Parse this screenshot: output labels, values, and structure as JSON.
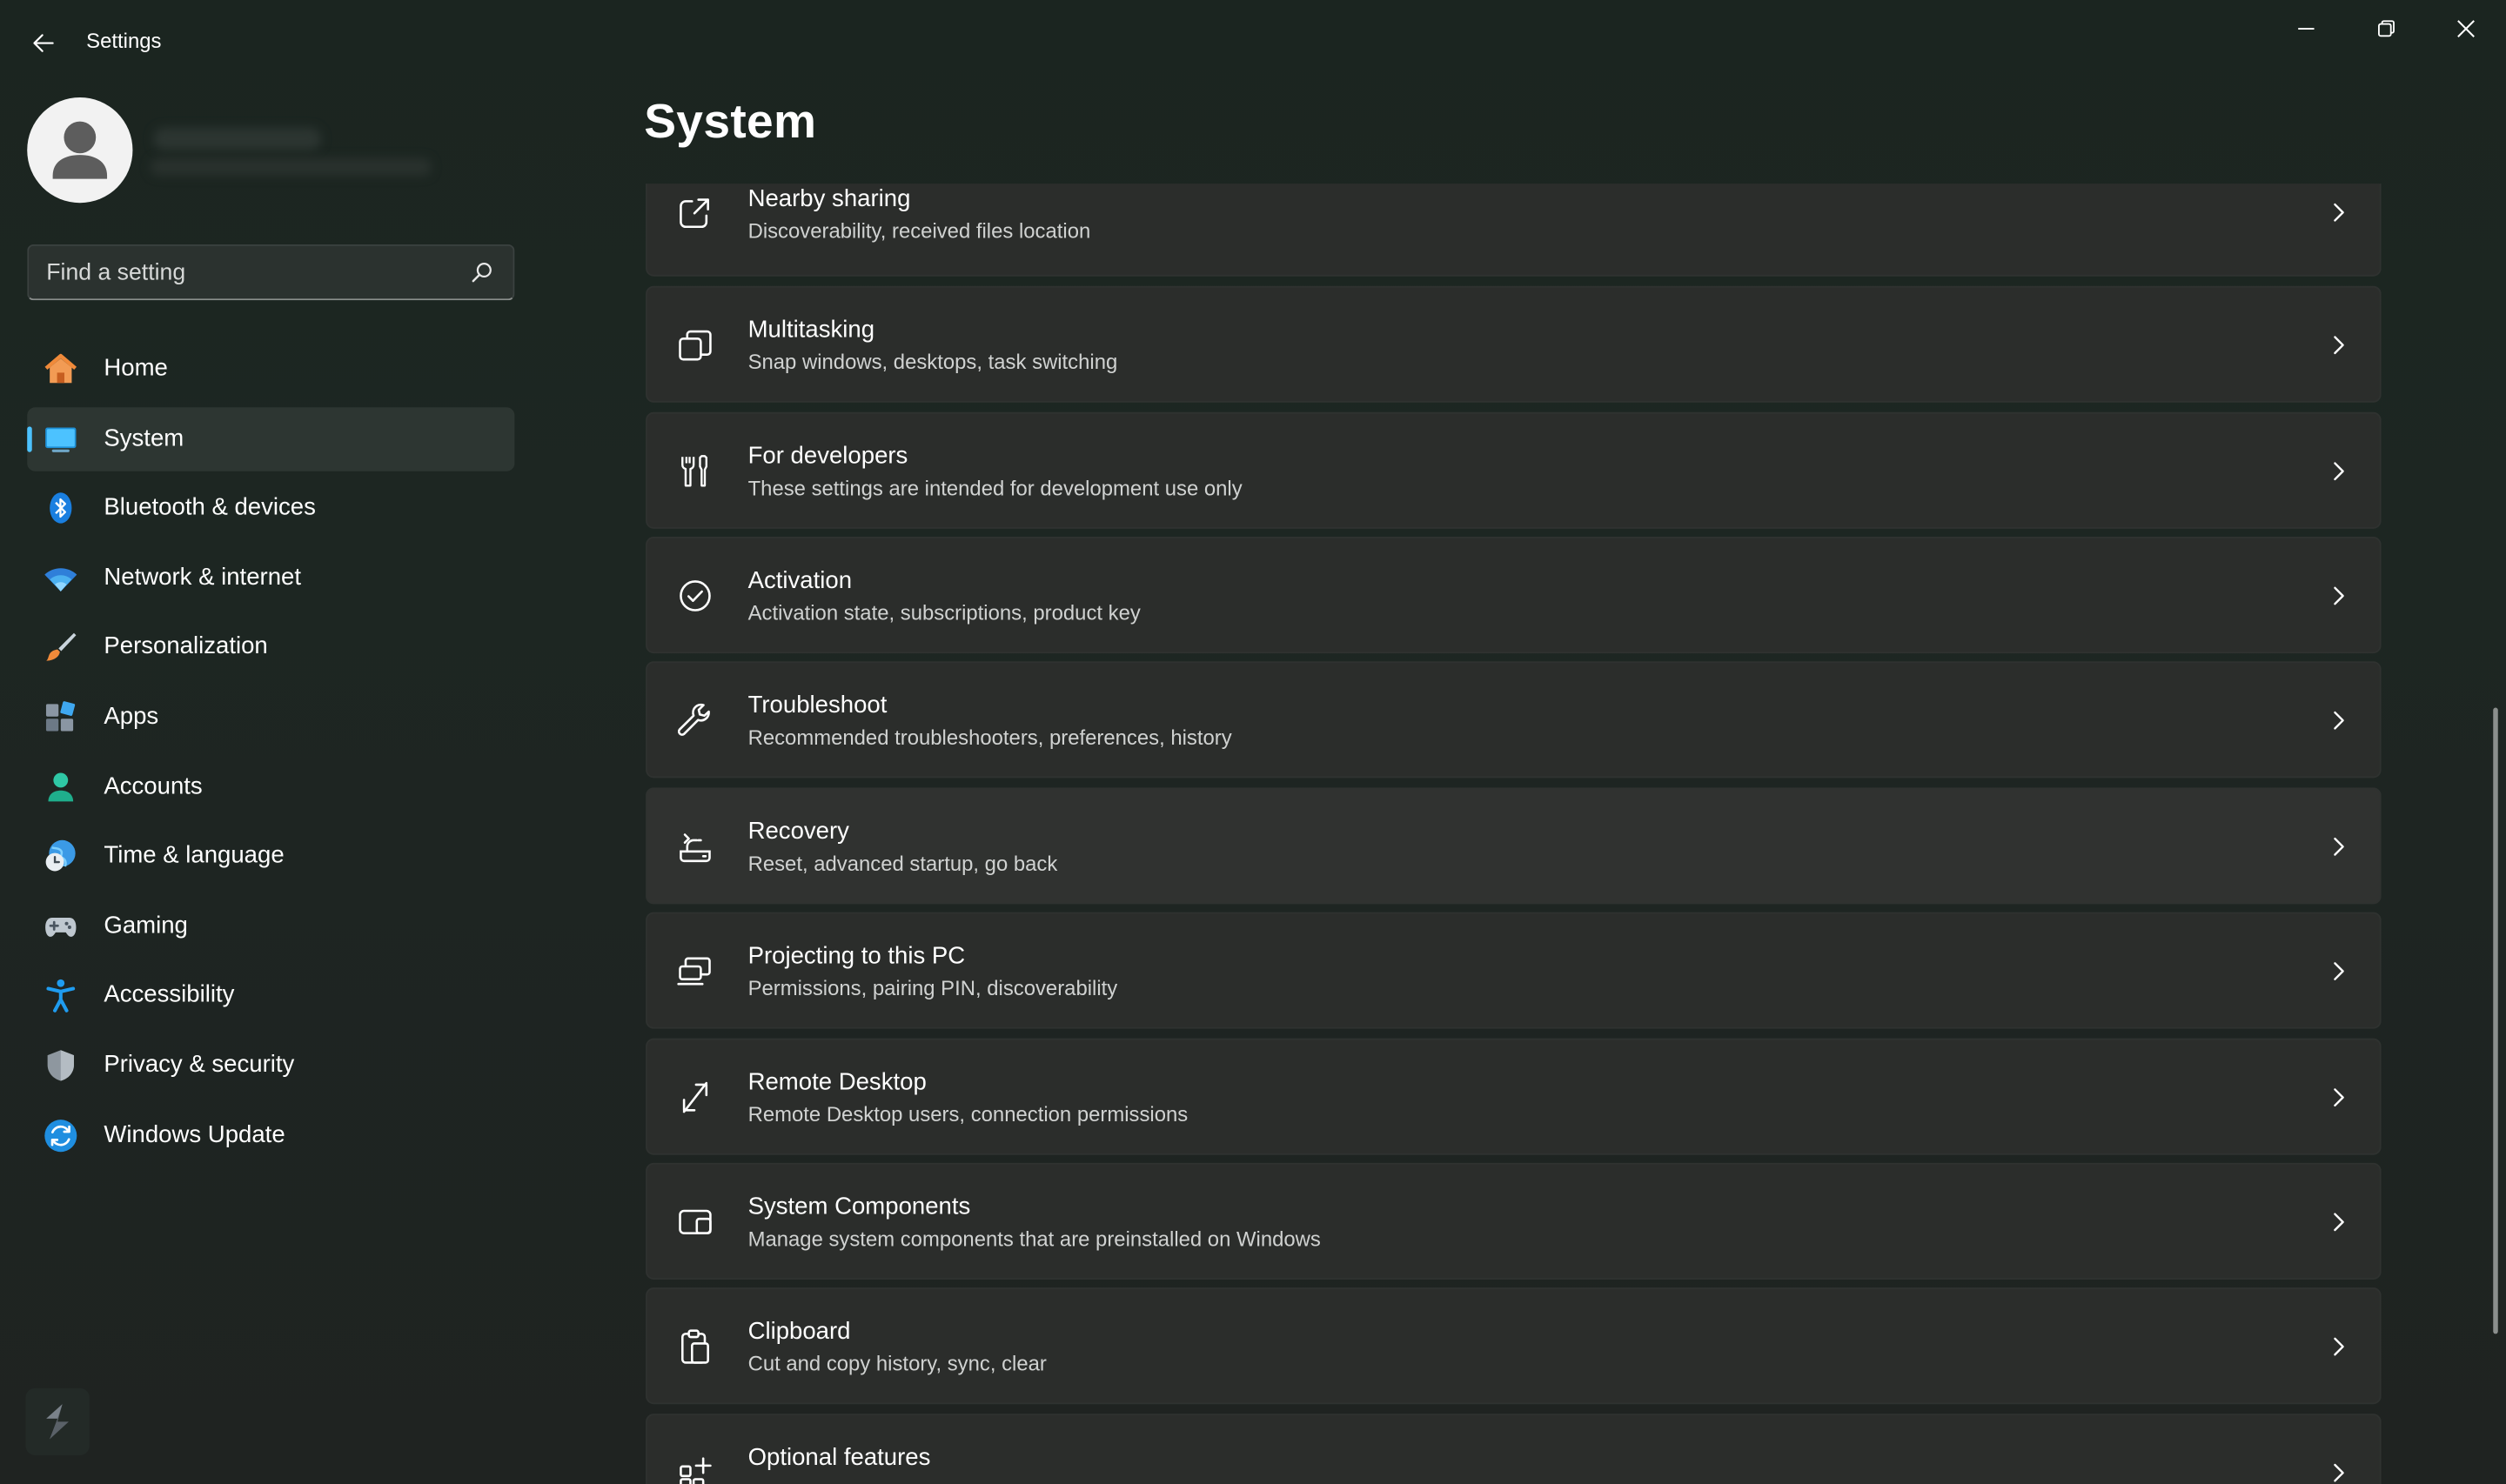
{
  "window": {
    "title": "Settings",
    "minimize_icon": "minimize-icon",
    "restore_icon": "restore-icon",
    "close_icon": "close-icon"
  },
  "search": {
    "placeholder": "Find a setting"
  },
  "nav": {
    "items": [
      {
        "label": "Home",
        "icon": "home-icon",
        "selected": false
      },
      {
        "label": "System",
        "icon": "system-icon",
        "selected": true
      },
      {
        "label": "Bluetooth & devices",
        "icon": "bluetooth-icon",
        "selected": false
      },
      {
        "label": "Network & internet",
        "icon": "wifi-icon",
        "selected": false
      },
      {
        "label": "Personalization",
        "icon": "brush-icon",
        "selected": false
      },
      {
        "label": "Apps",
        "icon": "apps-icon",
        "selected": false
      },
      {
        "label": "Accounts",
        "icon": "accounts-icon",
        "selected": false
      },
      {
        "label": "Time & language",
        "icon": "time-language-icon",
        "selected": false
      },
      {
        "label": "Gaming",
        "icon": "gamepad-icon",
        "selected": false
      },
      {
        "label": "Accessibility",
        "icon": "accessibility-icon",
        "selected": false
      },
      {
        "label": "Privacy & security",
        "icon": "shield-icon",
        "selected": false
      },
      {
        "label": "Windows Update",
        "icon": "update-icon",
        "selected": false
      }
    ]
  },
  "main": {
    "title": "System",
    "cards": [
      {
        "title": "Nearby sharing",
        "subtitle": "Discoverability, received files location",
        "icon": "share-icon"
      },
      {
        "title": "Multitasking",
        "subtitle": "Snap windows, desktops, task switching",
        "icon": "multitasking-icon"
      },
      {
        "title": "For developers",
        "subtitle": "These settings are intended for development use only",
        "icon": "developer-tools-icon"
      },
      {
        "title": "Activation",
        "subtitle": "Activation state, subscriptions, product key",
        "icon": "check-circle-icon"
      },
      {
        "title": "Troubleshoot",
        "subtitle": "Recommended troubleshooters, preferences, history",
        "icon": "wrench-icon"
      },
      {
        "title": "Recovery",
        "subtitle": "Reset, advanced startup, go back",
        "icon": "recovery-icon"
      },
      {
        "title": "Projecting to this PC",
        "subtitle": "Permissions, pairing PIN, discoverability",
        "icon": "projecting-icon"
      },
      {
        "title": "Remote Desktop",
        "subtitle": "Remote Desktop users, connection permissions",
        "icon": "remote-desktop-icon"
      },
      {
        "title": "System Components",
        "subtitle": "Manage system components that are preinstalled on Windows",
        "icon": "system-components-icon"
      },
      {
        "title": "Clipboard",
        "subtitle": "Cut and copy history, sync, clear",
        "icon": "clipboard-icon"
      },
      {
        "title": "Optional features",
        "subtitle": "",
        "icon": "optional-features-icon"
      }
    ]
  },
  "colors": {
    "accent": "#4cc2ff",
    "background": "#1c2420",
    "card": "#2b2d2b"
  }
}
